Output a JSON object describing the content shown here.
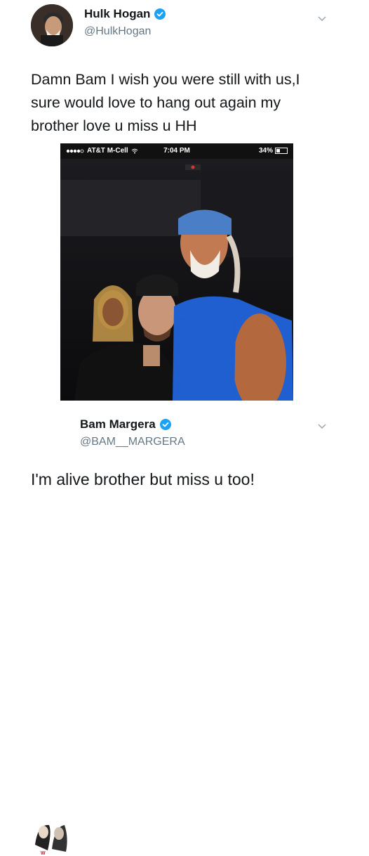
{
  "tweet1": {
    "name": "Hulk Hogan",
    "handle": "@HulkHogan",
    "text_lines": [
      "Damn Bam I wish you were still with us,I",
      "sure would love to hang out again my",
      "brother love u miss u HH"
    ],
    "photo": {
      "status": {
        "carrier": "AT&T M-Cell",
        "time": "7:04 PM",
        "battery": "34%"
      }
    }
  },
  "tweet2": {
    "name": "Bam Margera",
    "handle": "@BAM__MARGERA",
    "text": "I'm alive brother but miss u too!"
  },
  "icons": {
    "verified": "verified-badge-icon",
    "more": "chevron-down-icon",
    "wifi": "wifi-icon",
    "battery": "battery-icon",
    "signal": "signal-dots-icon"
  },
  "colors": {
    "verified": "#1da1f2",
    "text": "#14171a",
    "secondary": "#657786"
  }
}
